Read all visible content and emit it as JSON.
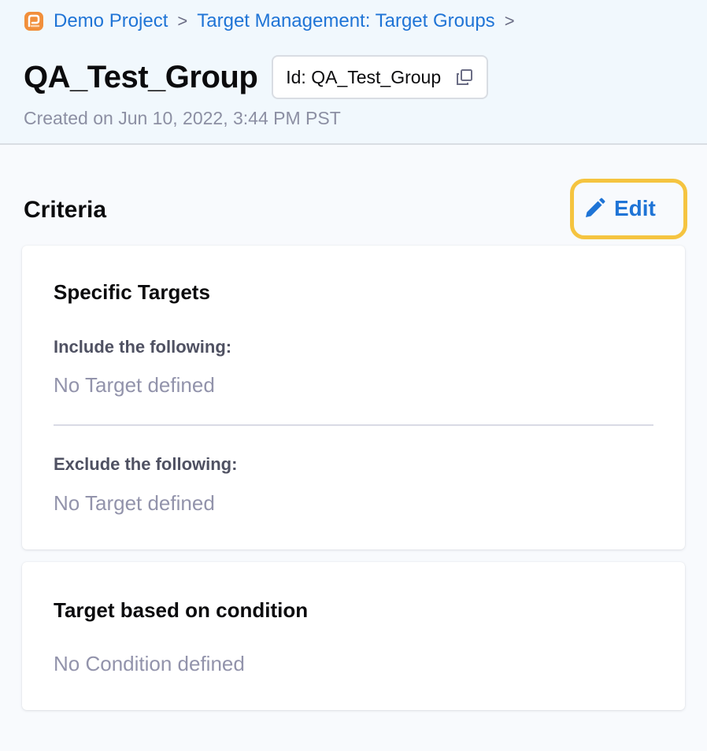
{
  "breadcrumb": {
    "items": [
      "Demo Project",
      "Target Management: Target Groups"
    ],
    "separator": ">"
  },
  "page": {
    "title": "QA_Test_Group",
    "id_chip": "Id: QA_Test_Group",
    "created": "Created on Jun 10, 2022, 3:44 PM PST"
  },
  "criteria": {
    "title": "Criteria",
    "edit_label": "Edit",
    "specific_targets": {
      "heading": "Specific Targets",
      "include_label": "Include the following:",
      "include_empty": "No Target defined",
      "exclude_label": "Exclude the following:",
      "exclude_empty": "No Target defined"
    },
    "condition": {
      "heading": "Target based on condition",
      "empty": "No Condition defined"
    }
  },
  "icons": {
    "project": "project-logo-icon",
    "copy": "copy-icon",
    "edit": "pencil-icon",
    "chevron": "chevron-right-icon"
  },
  "colors": {
    "link": "#1f74d6",
    "highlight": "#f5c440",
    "muted": "#9293ab"
  }
}
